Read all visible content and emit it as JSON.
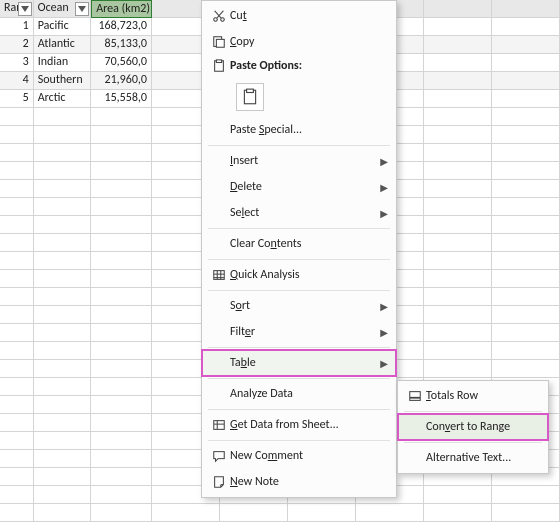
{
  "headers": {
    "rank": "Rank",
    "ocean": "Ocean",
    "area": "Area (km2)"
  },
  "rows": [
    {
      "rank": "1",
      "ocean": "Pacific",
      "area": "168,723,0"
    },
    {
      "rank": "2",
      "ocean": "Atlantic",
      "area": "85,133,0"
    },
    {
      "rank": "3",
      "ocean": "Indian",
      "area": "70,560,0"
    },
    {
      "rank": "4",
      "ocean": "Southern",
      "area": "21,960,0"
    },
    {
      "rank": "5",
      "ocean": "Arctic",
      "area": "15,558,0"
    }
  ],
  "menu": {
    "cut": "Cut",
    "copy": "Copy",
    "pasteOptions": "Paste Options:",
    "pasteSpecial": "Paste Special...",
    "insert": "Insert",
    "delete": "Delete",
    "select": "Select",
    "clearContents": "Clear Contents",
    "quickAnalysis": "Quick Analysis",
    "sort": "Sort",
    "filter": "Filter",
    "table": "Table",
    "analyzeData": "Analyze Data",
    "getData": "Get Data from Sheet...",
    "newComment": "New Comment",
    "newNote": "New Note"
  },
  "submenu": {
    "totalsRow": "Totals Row",
    "convertToRange": "Convert to Range",
    "alternativeText": "Alternative Text..."
  }
}
